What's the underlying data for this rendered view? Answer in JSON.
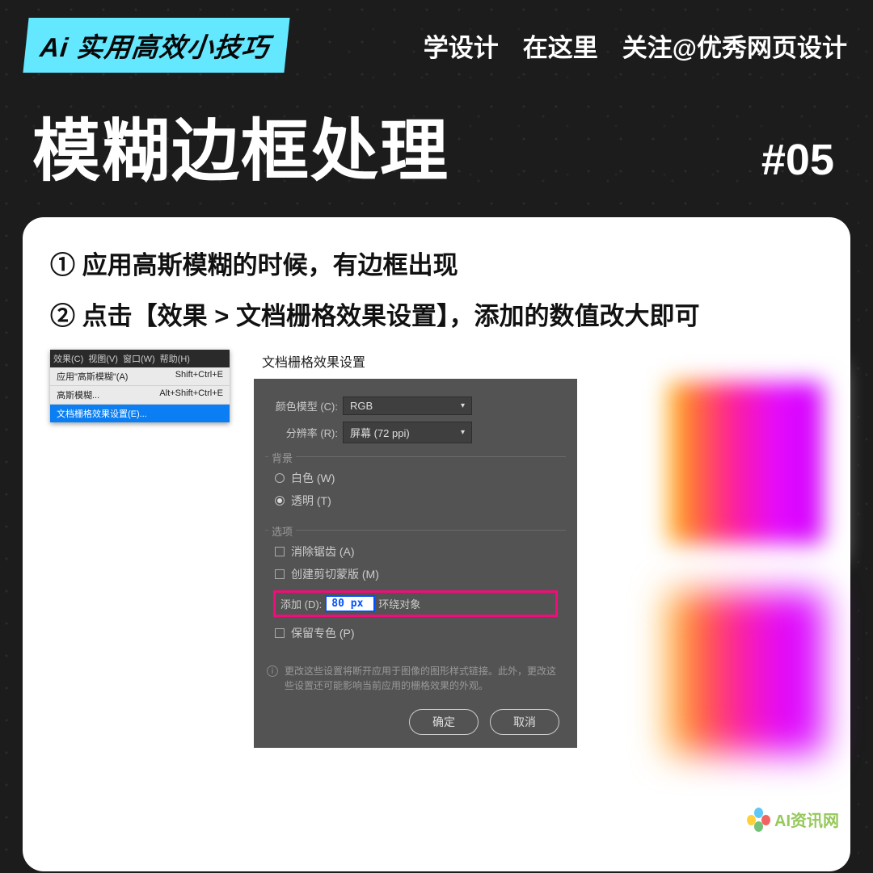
{
  "header": {
    "badge": "Ai 实用高效小技巧",
    "tag1": "学设计",
    "tag2": "在这里",
    "follow": "关注@优秀网页设计"
  },
  "title": "模糊边框处理",
  "number": "#05",
  "steps": {
    "s1": "① 应用高斯模糊的时候，有边框出现",
    "s2": "② 点击【效果 > 文档栅格效果设置】，添加的数值改大即可"
  },
  "menu": {
    "head1": "效果(C)",
    "head2": "视图(V)",
    "head3": "窗口(W)",
    "head4": "帮助(H)",
    "r1l": "应用\"高斯模糊\"(A)",
    "r1r": "Shift+Ctrl+E",
    "r2l": "高斯模糊...",
    "r2r": "Alt+Shift+Ctrl+E",
    "r3l": "文档栅格效果设置(E)..."
  },
  "dialog": {
    "title": "文档栅格效果设置",
    "colorModelLabel": "颜色模型 (C):",
    "colorModelValue": "RGB",
    "resolutionLabel": "分辨率 (R):",
    "resolutionValue": "屏幕 (72 ppi)",
    "bgLegend": "背景",
    "bgWhite": "白色 (W)",
    "bgTransparent": "透明 (T)",
    "optLegend": "选项",
    "antiAlias": "消除锯齿 (A)",
    "clipMask": "创建剪切蒙版 (M)",
    "addLabel": "添加 (D):",
    "addValue": "80 px",
    "addSuffix": "环绕对象",
    "spot": "保留专色 (P)",
    "info": "更改这些设置将断开应用于图像的图形样式链接。此外，更改这些设置还可能影响当前应用的栅格效果的外观。",
    "ok": "确定",
    "cancel": "取消"
  },
  "watermark": "AI资讯网"
}
